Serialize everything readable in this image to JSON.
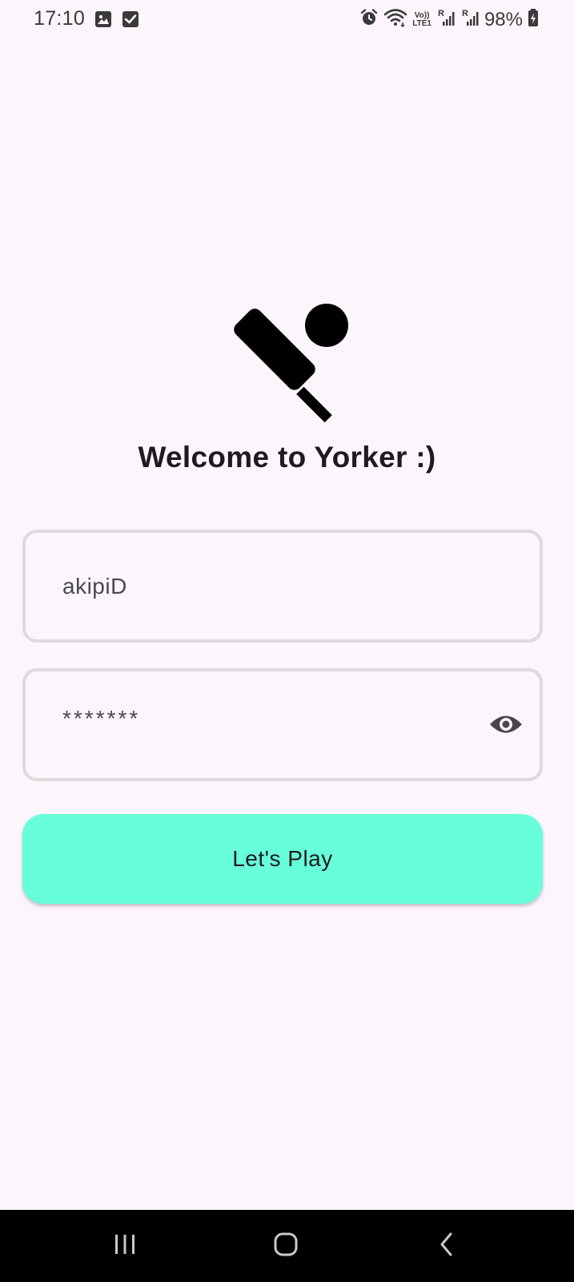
{
  "status_bar": {
    "time": "17:10",
    "left_icons": [
      "image-icon",
      "check-box-icon"
    ],
    "right_icons": [
      "alarm-icon",
      "wifi-icon",
      "volte-icon",
      "signal-r-icon",
      "signal-r-icon"
    ],
    "volte_line1": "Vo))",
    "volte_line2": "LTE1",
    "signal_label": "R",
    "battery_percent": "98%"
  },
  "logo": {
    "icon": "cricket-bat-ball-icon",
    "color": "#000000"
  },
  "welcome": {
    "title": "Welcome to Yorker :)"
  },
  "form": {
    "username_value": "akipiD",
    "password_value": "*******",
    "password_toggle_icon": "eye-icon"
  },
  "actions": {
    "play_label": "Let's Play",
    "play_color": "#67ffd9"
  },
  "nav_bar": {
    "recents_icon": "recents-icon",
    "home_icon": "home-icon",
    "back_icon": "back-icon"
  },
  "colors": {
    "background": "#fcf5fb",
    "field_border": "#dcdadd",
    "text": "#1d1b20"
  }
}
